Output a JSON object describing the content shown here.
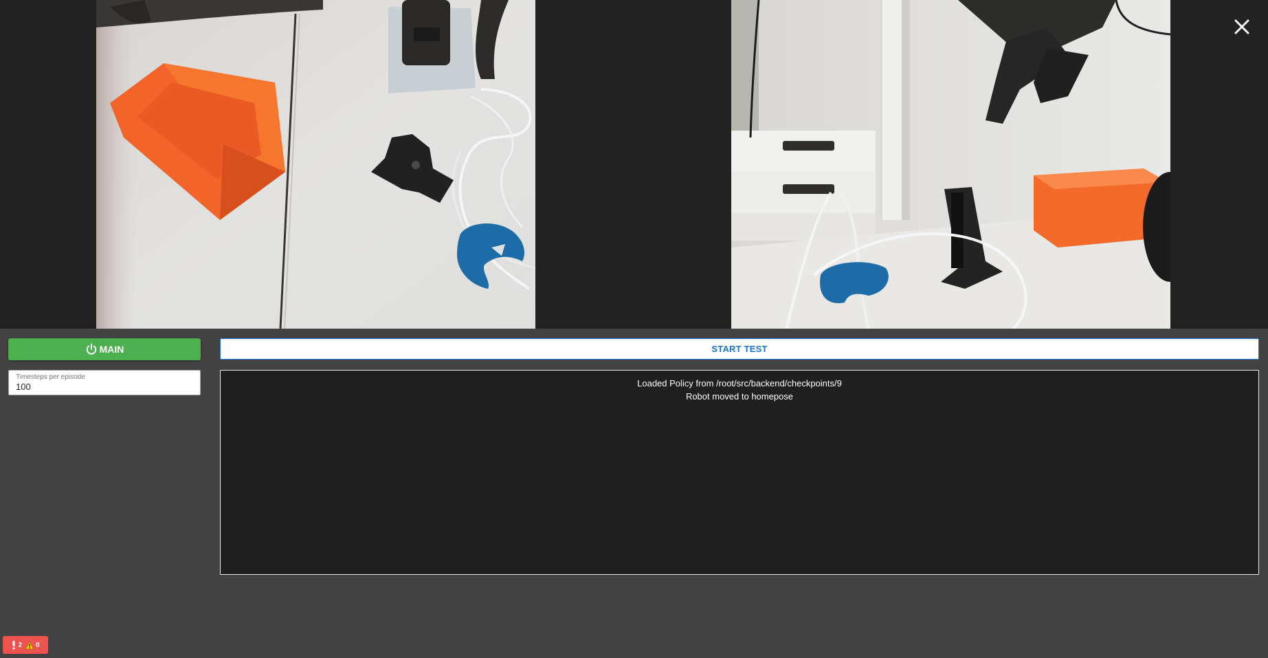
{
  "cameras": [
    {
      "name": "left-camera-feed"
    },
    {
      "name": "right-camera-feed"
    }
  ],
  "controls": {
    "main_label": "MAIN",
    "timesteps": {
      "label": "Timesteps per episode",
      "value": "100"
    },
    "start_test_label": "START TEST"
  },
  "log": {
    "lines": [
      "Loaded Policy from /root/src/backend/checkpoints/9",
      "Robot moved to homepose"
    ]
  },
  "badge": {
    "errors": "2",
    "warnings": "0"
  },
  "icons": {
    "close": "close-icon",
    "power": "power-icon",
    "error": "error-icon",
    "warning": "warning-icon"
  },
  "colors": {
    "page_background": "#434343",
    "camera_strip_background": "#222222",
    "main_button": "#4caf50",
    "accent_blue": "#1976d2",
    "log_background": "#1f1f1f",
    "error_badge": "#ef5350"
  }
}
